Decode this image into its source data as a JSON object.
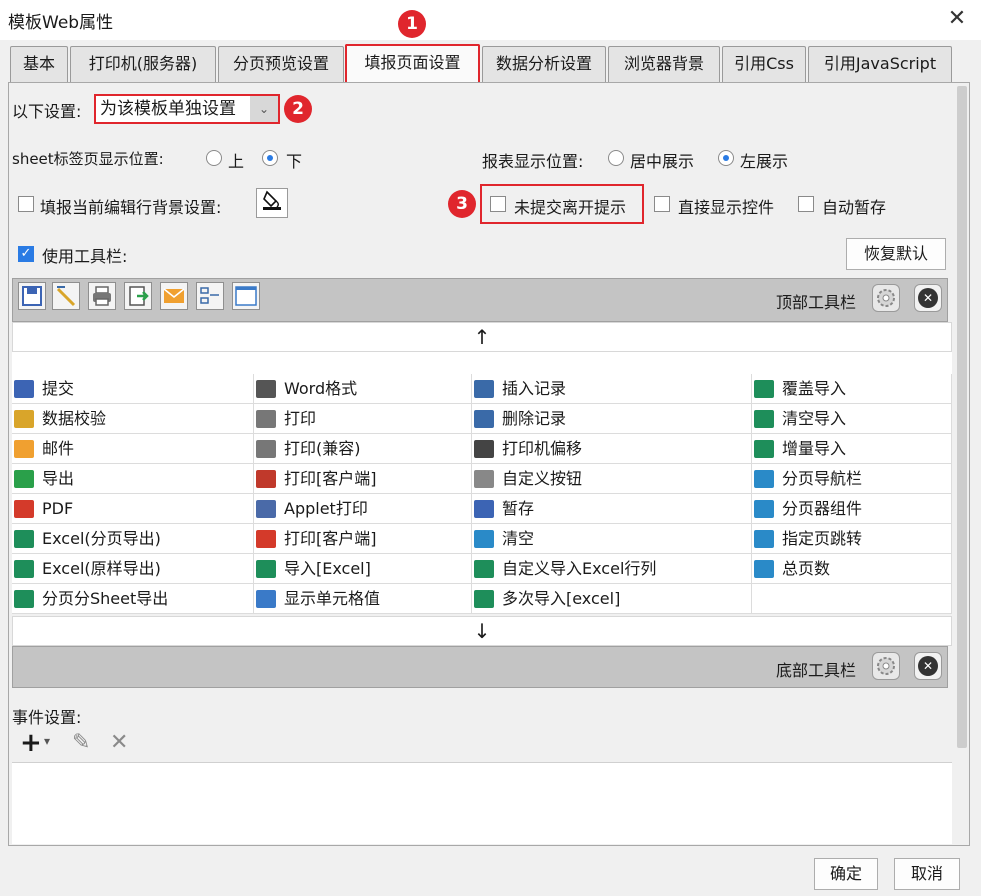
{
  "window": {
    "title": "模板Web属性",
    "close_label": "✕"
  },
  "tabs": [
    {
      "label": "基本"
    },
    {
      "label": "打印机(服务器)"
    },
    {
      "label": "分页预览设置"
    },
    {
      "label": "填报页面设置"
    },
    {
      "label": "数据分析设置"
    },
    {
      "label": "浏览器背景"
    },
    {
      "label": "引用Css"
    },
    {
      "label": "引用JavaScript"
    }
  ],
  "badges": [
    "1",
    "2",
    "3"
  ],
  "settings": {
    "label": "以下设置:",
    "value": "为该模板单独设置",
    "dropdown_glyph": "⌄"
  },
  "sheet_tab": {
    "label": "sheet标签页显示位置:",
    "options": [
      {
        "label": "上",
        "checked": false
      },
      {
        "label": "下",
        "checked": true
      }
    ]
  },
  "report_position": {
    "label": "报表显示位置:",
    "options": [
      {
        "label": "居中展示",
        "checked": false
      },
      {
        "label": "左展示",
        "checked": true
      }
    ]
  },
  "checkboxes": {
    "edit_row_bg": {
      "label": "填报当前编辑行背景设置:",
      "checked": false
    },
    "unsubmitted_prompt": {
      "label": "未提交离开提示",
      "checked": false
    },
    "direct_show": {
      "label": "直接显示控件",
      "checked": false
    },
    "auto_save": {
      "label": "自动暂存",
      "checked": false
    },
    "use_toolbar": {
      "label": "使用工具栏:",
      "checked": true
    }
  },
  "restore_default": "恢复默认",
  "top_toolbar": {
    "label": "顶部工具栏",
    "icons": [
      "save-icon",
      "validate-icon",
      "print-icon",
      "export-icon",
      "email-icon",
      "insert-record-icon",
      "cell-value-icon"
    ]
  },
  "bottom_toolbar": {
    "label": "底部工具栏"
  },
  "arrows": {
    "up": "↑",
    "down": "↓"
  },
  "grid": {
    "columns": [
      [
        {
          "label": "提交",
          "icon": "save-icon",
          "color": "#3c64b4"
        },
        {
          "label": "数据校验",
          "icon": "validate-icon",
          "color": "#d9a52a"
        },
        {
          "label": "邮件",
          "icon": "email-icon",
          "color": "#f0a030"
        },
        {
          "label": "导出",
          "icon": "export-icon",
          "color": "#2aa04a"
        },
        {
          "label": "PDF",
          "icon": "pdf-icon",
          "color": "#d43a2a"
        },
        {
          "label": "Excel(分页导出)",
          "icon": "excel-icon",
          "color": "#1e8e5a"
        },
        {
          "label": "Excel(原样导出)",
          "icon": "excel-icon",
          "color": "#1e8e5a"
        },
        {
          "label": "分页分Sheet导出",
          "icon": "excel-icon",
          "color": "#1e8e5a"
        }
      ],
      [
        {
          "label": "Word格式",
          "icon": "word-icon",
          "color": "#555555"
        },
        {
          "label": "打印",
          "icon": "print-icon",
          "color": "#777777"
        },
        {
          "label": "打印(兼容)",
          "icon": "print-icon",
          "color": "#777777"
        },
        {
          "label": "打印[客户端]",
          "icon": "flash-print-icon",
          "color": "#c0392b"
        },
        {
          "label": "Applet打印",
          "icon": "applet-print-icon",
          "color": "#4a6aa8"
        },
        {
          "label": "打印[客户端]",
          "icon": "pdf-print-icon",
          "color": "#d43a2a"
        },
        {
          "label": "导入[Excel]",
          "icon": "excel-icon",
          "color": "#1e8e5a"
        },
        {
          "label": "显示单元格值",
          "icon": "cell-value-icon",
          "color": "#3a7ac8"
        }
      ],
      [
        {
          "label": "插入记录",
          "icon": "insert-record-icon",
          "color": "#3a6aa8"
        },
        {
          "label": "删除记录",
          "icon": "delete-record-icon",
          "color": "#3a6aa8"
        },
        {
          "label": "打印机偏移",
          "icon": "move-icon",
          "color": "#444444"
        },
        {
          "label": "自定义按钮",
          "icon": "gear-icon",
          "color": "#888888"
        },
        {
          "label": "暂存",
          "icon": "temp-save-icon",
          "color": "#3c64b4"
        },
        {
          "label": "清空",
          "icon": "eraser-icon",
          "color": "#2a8ac8"
        },
        {
          "label": "自定义导入Excel行列",
          "icon": "excel-icon",
          "color": "#1e8e5a"
        },
        {
          "label": "多次导入[excel]",
          "icon": "excel-icon",
          "color": "#1e8e5a"
        }
      ],
      [
        {
          "label": "覆盖导入",
          "icon": "excel-icon",
          "color": "#1e8e5a"
        },
        {
          "label": "清空导入",
          "icon": "excel-icon",
          "color": "#1e8e5a"
        },
        {
          "label": "增量导入",
          "icon": "excel-icon",
          "color": "#1e8e5a"
        },
        {
          "label": "分页导航栏",
          "icon": "page-nav-icon",
          "color": "#2a8ac8"
        },
        {
          "label": "分页器组件",
          "icon": "pager-icon",
          "color": "#2a8ac8"
        },
        {
          "label": "指定页跳转",
          "icon": "page-nav-icon",
          "color": "#2a8ac8"
        },
        {
          "label": "总页数",
          "icon": "page-nav-icon",
          "color": "#2a8ac8"
        },
        {
          "label": "",
          "icon": "",
          "color": ""
        }
      ]
    ]
  },
  "events": {
    "label": "事件设置:",
    "add_glyph": "+",
    "add_caret": "▾",
    "edit_glyph": "✎",
    "delete_glyph": "✕"
  },
  "footer": {
    "ok": "确定",
    "cancel": "取消"
  }
}
